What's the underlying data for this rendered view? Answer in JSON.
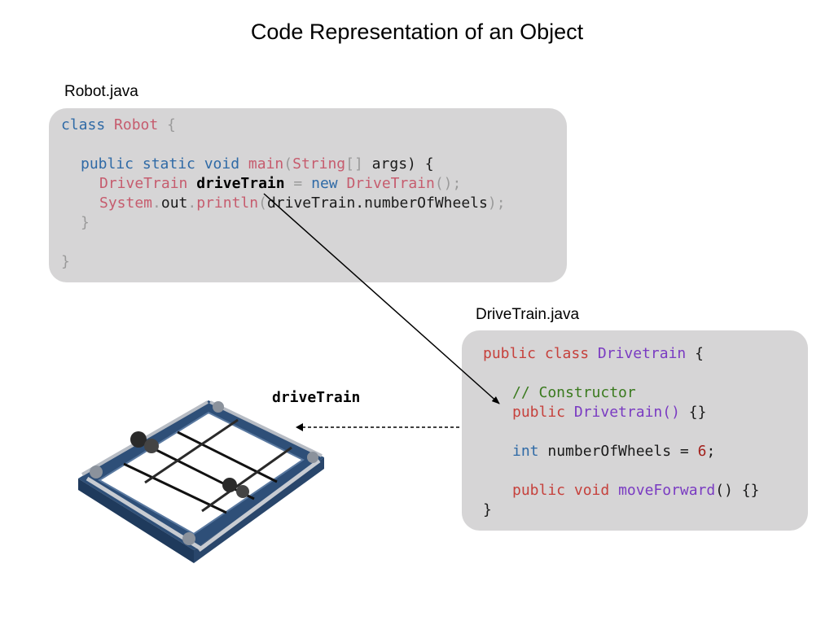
{
  "title": "Code Representation of an Object",
  "robot_file": {
    "filename": "Robot.java",
    "lines": {
      "l1": {
        "a": "class",
        "b": " ",
        "c": "Robot",
        "d": " {"
      },
      "l3": {
        "a": "public static void",
        "b": " ",
        "c": "main",
        "d": "(",
        "e": "String",
        "f": "[]",
        "g": " args",
        "h": ") {"
      },
      "l4": {
        "a": "DriveTrain",
        "b": " ",
        "c": "driveTrain",
        "d": " = ",
        "e": "new",
        "f": " ",
        "g": "DriveTrain",
        "h": "();"
      },
      "l5": {
        "a": "System",
        "b": ".",
        "c": "out",
        "d": ".",
        "e": "println",
        "f": "(",
        "g": "driveTrain.numberOfWheels",
        "h": ");"
      },
      "l6": "}",
      "l8": "}"
    }
  },
  "drivetrain_file": {
    "filename": "DriveTrain.java",
    "lines": {
      "l1": {
        "a": "public class",
        "b": " ",
        "c": "Drivetrain",
        "d": " {"
      },
      "l3": "// Constructor",
      "l4": {
        "a": "public",
        "b": " ",
        "c": "Drivetrain()",
        "d": " {}"
      },
      "l6": {
        "a": "int",
        "b": " numberOfWheels = ",
        "c": "6",
        "d": ";"
      },
      "l8": {
        "a": "public void",
        "b": " ",
        "c": "moveForward",
        "d": "() {}"
      },
      "l9": "}"
    }
  },
  "object_label": "driveTrain",
  "image": {
    "icon": "robot-drivetrain-chassis-image"
  }
}
